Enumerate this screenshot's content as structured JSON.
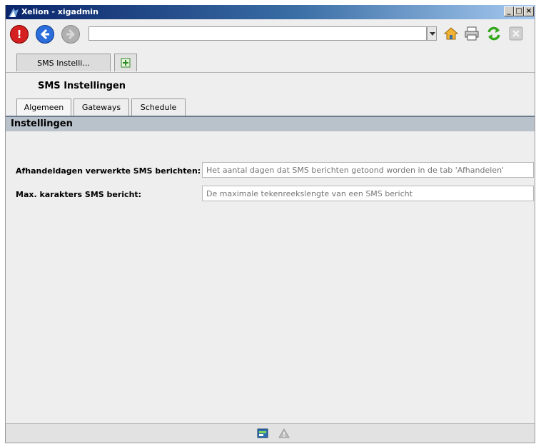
{
  "window": {
    "title": "Xelion - xigadmin",
    "controls": [
      "_",
      "□",
      "×"
    ]
  },
  "toolbar": {
    "address_value": "",
    "icons": [
      "stop-icon",
      "back-icon",
      "forward-icon",
      "dropdown-arrow-icon",
      "home-icon",
      "print-icon",
      "refresh-icon",
      "close-tab-icon"
    ]
  },
  "tabs": {
    "items": [
      {
        "label": "SMS Instelli..."
      }
    ],
    "new_tab_icon": "new-tab-icon"
  },
  "page": {
    "title": "SMS Instellingen",
    "sub_tabs": [
      {
        "label": "Algemeen"
      },
      {
        "label": "Gateways"
      },
      {
        "label": "Schedule"
      }
    ],
    "section_title": "Instellingen",
    "fields": [
      {
        "label": "Afhandeldagen verwerkte SMS berichten:",
        "placeholder": "Het aantal dagen dat SMS berichten getoond worden in de tab 'Afhandelen'"
      },
      {
        "label": "Max. karakters SMS bericht:",
        "placeholder": "De maximale tekenreekslengte van een SMS bericht"
      }
    ]
  },
  "statusbar": {
    "icons": [
      "sms-status-icon",
      "warning-icon"
    ]
  },
  "colors": {
    "title_gradient_start": "#0a246a",
    "section_header": "#b9c1cb",
    "stop_red": "#d42020",
    "back_blue": "#2a6ddb",
    "refresh_green": "#35a81e"
  }
}
